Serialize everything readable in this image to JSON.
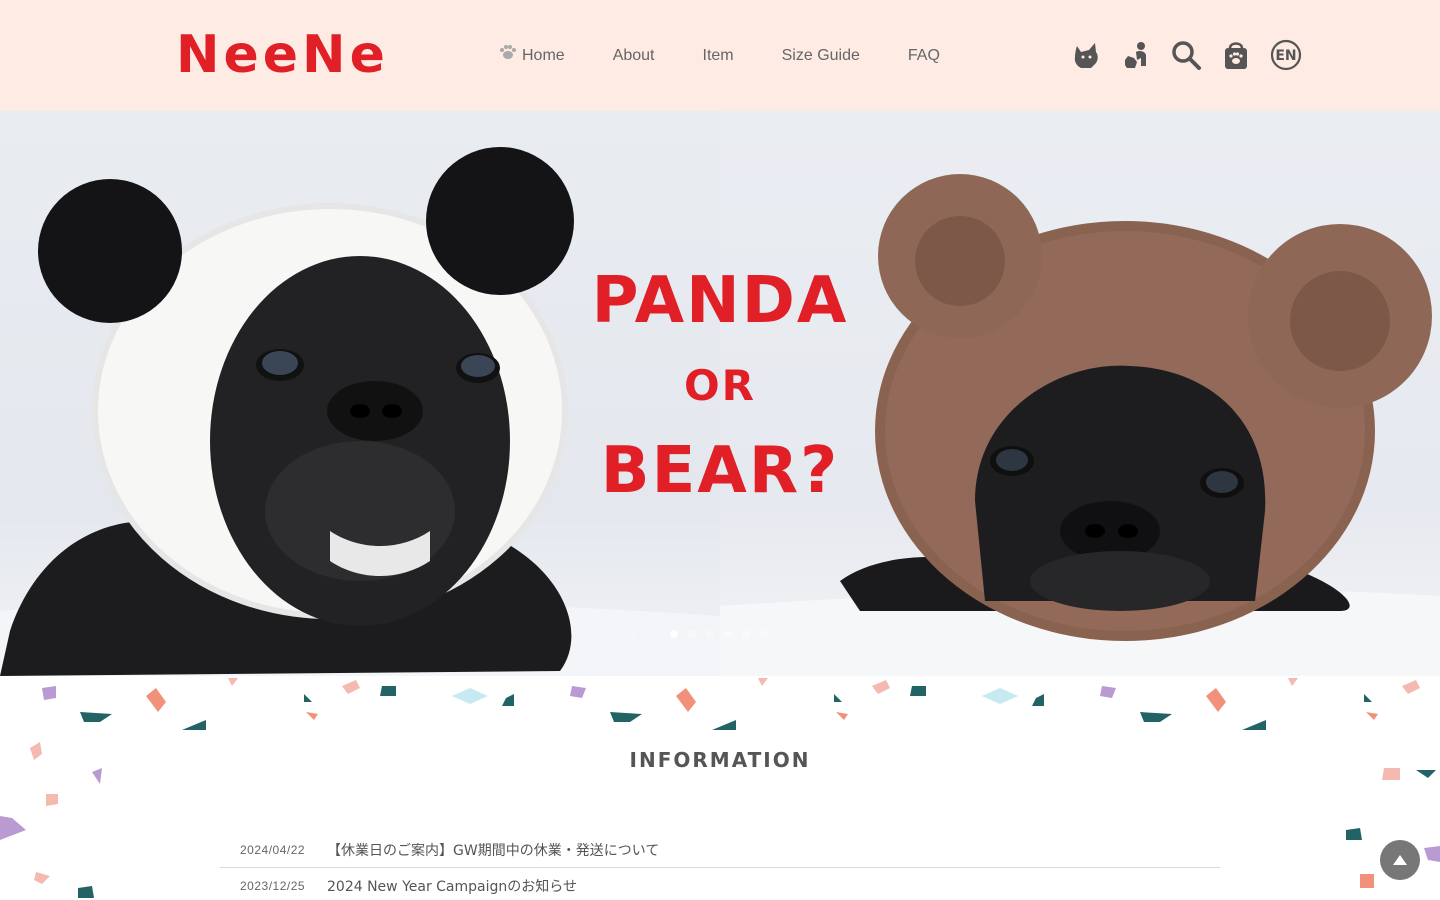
{
  "brand": {
    "logo": "NeeNe",
    "accent": "#e01f26",
    "header_bg": "#fdebe4"
  },
  "nav": {
    "items": [
      {
        "label": "Home",
        "icon": "paw-icon"
      },
      {
        "label": "About"
      },
      {
        "label": "Item"
      },
      {
        "label": "Size Guide"
      },
      {
        "label": "FAQ"
      }
    ]
  },
  "header_icons": [
    "french-bulldog-icon",
    "dog-owner-icon",
    "search-icon",
    "shopping-bag-icon",
    "language-en-icon"
  ],
  "language_badge": "EN",
  "hero": {
    "line1": "PANDA",
    "line2": "OR",
    "line3": "BEAR?",
    "prev": "‹",
    "next": "›",
    "slide_count": 6,
    "active_slide": 1
  },
  "information": {
    "title": "INFORMATION",
    "items": [
      {
        "date": "2024/04/22",
        "text": "【休業日のご案内】GW期間中の休業・発送について"
      },
      {
        "date": "2023/12/25",
        "text": "2024 New Year Campaignのお知らせ"
      }
    ]
  }
}
